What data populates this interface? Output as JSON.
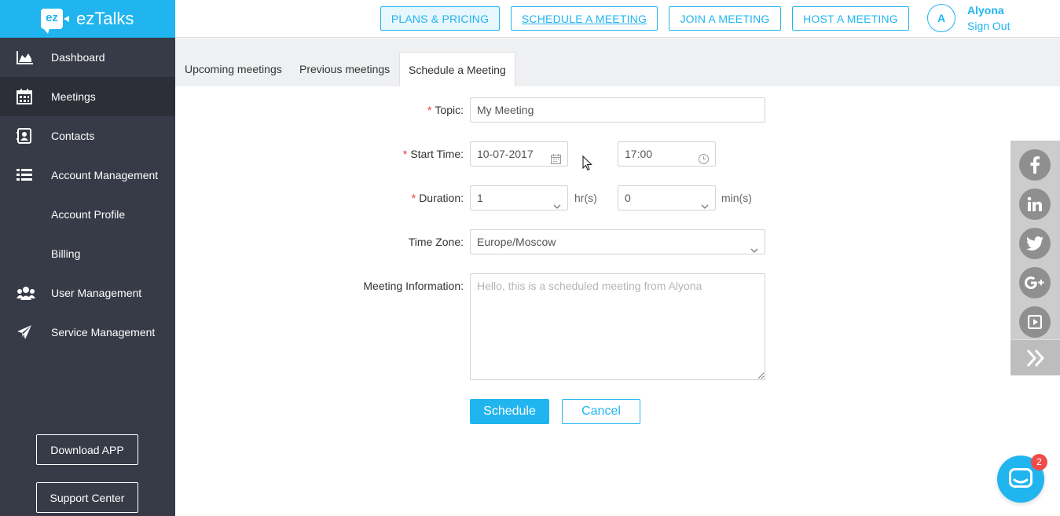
{
  "app": {
    "logo_mark": "ez",
    "name": "ezTalks"
  },
  "sidebar": {
    "items": [
      {
        "label": "Dashboard",
        "icon": "area-chart-icon"
      },
      {
        "label": "Meetings",
        "icon": "calendar-icon",
        "active": true
      },
      {
        "label": "Contacts",
        "icon": "contact-book-icon"
      },
      {
        "label": "Account Management",
        "icon": "list-icon"
      },
      {
        "label": "Account Profile"
      },
      {
        "label": "Billing"
      },
      {
        "label": "User Management",
        "icon": "users-icon"
      },
      {
        "label": "Service Management",
        "icon": "paper-plane-icon"
      }
    ],
    "download_app": "Download APP",
    "support_center": "Support Center"
  },
  "topbar": {
    "plans_pricing": "PLANS & PRICING",
    "schedule_meeting": "SCHEDULE A MEETING",
    "join_meeting": "JOIN A MEETING",
    "host_meeting": "HOST A MEETING",
    "avatar_initial": "A",
    "user_name": "Alyona",
    "sign_out": "Sign Out"
  },
  "tabs": [
    {
      "label": "Upcoming meetings"
    },
    {
      "label": "Previous meetings"
    },
    {
      "label": "Schedule a Meeting",
      "active": true
    }
  ],
  "form": {
    "topic_label": "Topic",
    "topic_value": "My Meeting",
    "start_time_label": "Start Time",
    "start_date": "10-07-2017",
    "start_clock": "17:00",
    "duration_label": "Duration",
    "duration_hours": "1",
    "hours_unit": "hr(s)",
    "duration_minutes": "0",
    "minutes_unit": "min(s)",
    "timezone_label": "Time Zone",
    "timezone_value": "Europe/Moscow",
    "info_label": "Meeting Information",
    "info_placeholder": "Hello, this is a scheduled meeting from Alyona",
    "required_mark": "*",
    "label_colon": ":",
    "schedule_button": "Schedule",
    "cancel_button": "Cancel"
  },
  "social": [
    "facebook-icon",
    "linkedin-icon",
    "twitter-icon",
    "google-plus-icon",
    "video-icon"
  ],
  "chat": {
    "badge_count": "2"
  },
  "colors": {
    "accent": "#21b5f0",
    "sidebar": "#373a47",
    "sidebar_active": "#2c2e38",
    "required": "#e53935"
  }
}
